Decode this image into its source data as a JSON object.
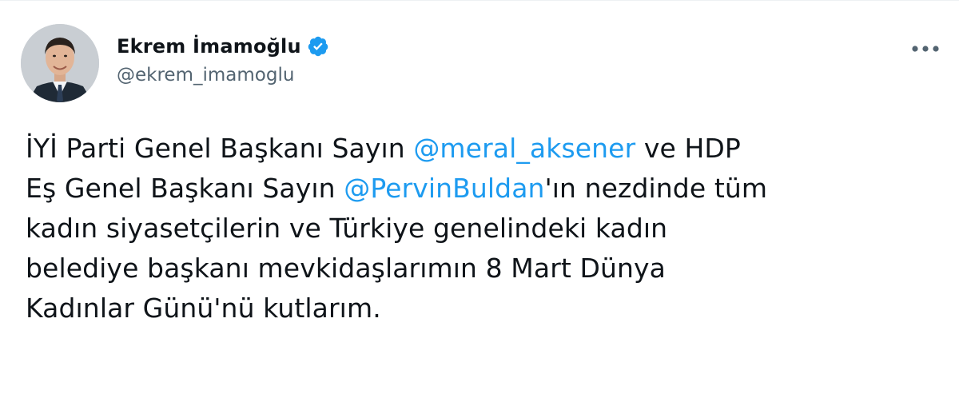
{
  "author": {
    "display_name": "Ekrem İmamoğlu",
    "handle": "@ekrem_imamoglu",
    "verified": true,
    "avatar_icon": "profile-photo"
  },
  "menu": {
    "icon": "more-horizontal-icon"
  },
  "tweet": {
    "lines": [
      {
        "before": "İYİ Parti Genel Başkanı Sayın ",
        "mention": "@meral_aksener",
        "after": " ve HDP"
      },
      {
        "before": "Eş Genel Başkanı Sayın ",
        "mention": "@PervinBuldan",
        "after": "'ın nezdinde tüm"
      },
      {
        "before": "kadın siyasetçilerin ve Türkiye genelindeki kadın",
        "mention": "",
        "after": ""
      },
      {
        "before": "belediye başkanı mevkidaşlarımın 8 Mart Dünya",
        "mention": "",
        "after": ""
      },
      {
        "before": "Kadınlar Günü'nü kutlarım.",
        "mention": "",
        "after": ""
      }
    ]
  },
  "colors": {
    "text": "#0f1419",
    "secondary": "#536471",
    "link": "#1d9bf0",
    "verified": "#1d9bf0"
  }
}
